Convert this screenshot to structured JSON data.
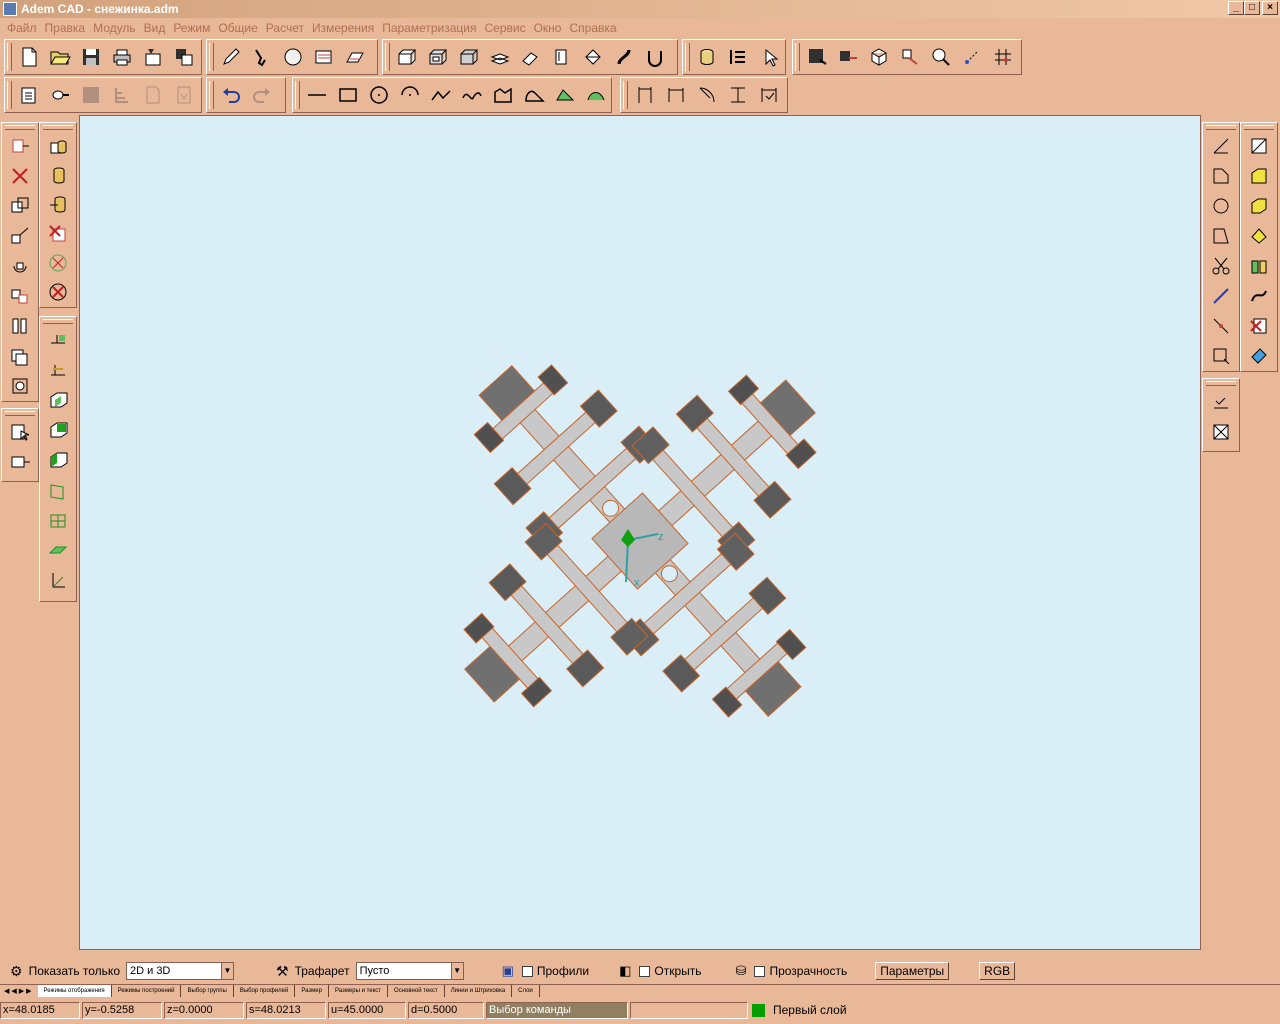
{
  "window": {
    "title": "Adem CAD - снежинка.adm",
    "min": "_",
    "max": "□",
    "close": "×"
  },
  "menu": [
    "Файл",
    "Правка",
    "Модуль",
    "Вид",
    "Режим",
    "Общие",
    "Расчет",
    "Измерения",
    "Параметризация",
    "Сервис",
    "Окно",
    "Справка"
  ],
  "options": {
    "show_only_label": "Показать только",
    "show_only_value": "2D и 3D",
    "stencil_label": "Трафарет",
    "stencil_value": "Пусто",
    "profiles_label": "Профили",
    "open_label": "Открыть",
    "transparency_label": "Прозрачность",
    "params_button": "Параметры",
    "rgb_button": "RGB"
  },
  "tabs": [
    "Режимы отображения",
    "Режимы построений",
    "Выбор группы",
    "Выбор профилей",
    "Размер",
    "Размеры и текст",
    "Основной текст",
    "Линии и Штриховка",
    "Слои"
  ],
  "status": {
    "x": "x=48.0185",
    "y": "y=-0.5258",
    "z": "z=0.0000",
    "s": "s=48.0213",
    "u": "u=45.0000",
    "d": "d=0.5000",
    "command": "Выбор команды",
    "layer": "Первый слой"
  },
  "colors": {
    "ui_bg": "#e8b898",
    "canvas": "#daeef8",
    "layer_indicator": "#00a000"
  }
}
